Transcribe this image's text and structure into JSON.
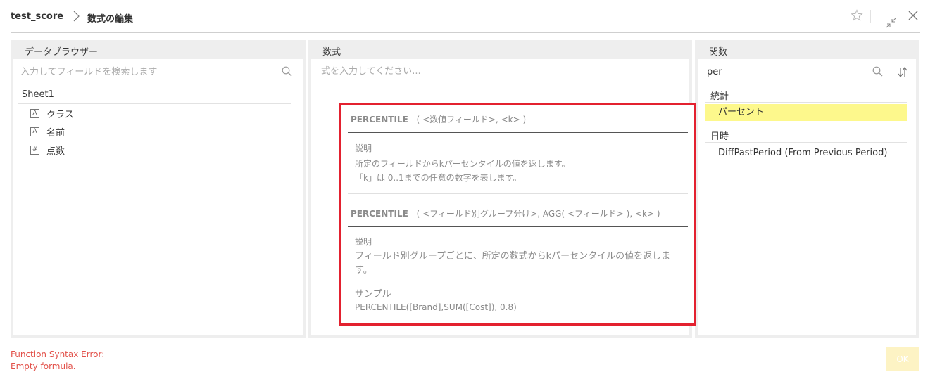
{
  "header": {
    "dataset_name": "test_score",
    "page_title": "数式の編集"
  },
  "data_browser": {
    "title": "データブラウザー",
    "search_placeholder": "入力してフィールドを検索します",
    "sheet_name": "Sheet1",
    "fields": [
      {
        "type": "A",
        "label": "クラス"
      },
      {
        "type": "A",
        "label": "名前"
      },
      {
        "type": "#",
        "label": "点数"
      }
    ]
  },
  "formula": {
    "title": "数式",
    "value": "",
    "placeholder": "式を入力してください..."
  },
  "tooltip": {
    "entries": [
      {
        "name": "PERCENTILE",
        "args": "( <数値フィールド>, <k> )",
        "desc_title": "説明",
        "desc_lines": [
          "所定のフィールドからkパーセンタイルの値を返します。",
          "「k」は 0..1までの任意の数字を表します。"
        ]
      },
      {
        "name": "PERCENTILE",
        "args": "( <フィールド別グループ分け>, AGG( <フィールド> ), <k> )",
        "desc_title": "説明",
        "desc_lines": [
          "フィールド別グループごとに、所定の数式からkパーセンタイルの値を返しま",
          "す。"
        ],
        "sample_title": "サンプル",
        "sample_code": "PERCENTILE([Brand],SUM([Cost]), 0.8)"
      }
    ]
  },
  "functions": {
    "title": "関数",
    "search_value": "per",
    "categories": [
      {
        "name": "統計",
        "items": [
          "パーセント"
        ]
      },
      {
        "name": "日時",
        "items": [
          "DiffPastPeriod (From Previous Period)"
        ]
      }
    ],
    "selected_item": "パーセント"
  },
  "footer": {
    "error_line1": "Function Syntax Error:",
    "error_line2": "Empty formula.",
    "ok_label": "OK"
  },
  "colors": {
    "error": "#e2514a",
    "highlight": "#fdf88c",
    "tooltip_border": "#e3212f",
    "ok_disabled": "#fdf3c4"
  }
}
